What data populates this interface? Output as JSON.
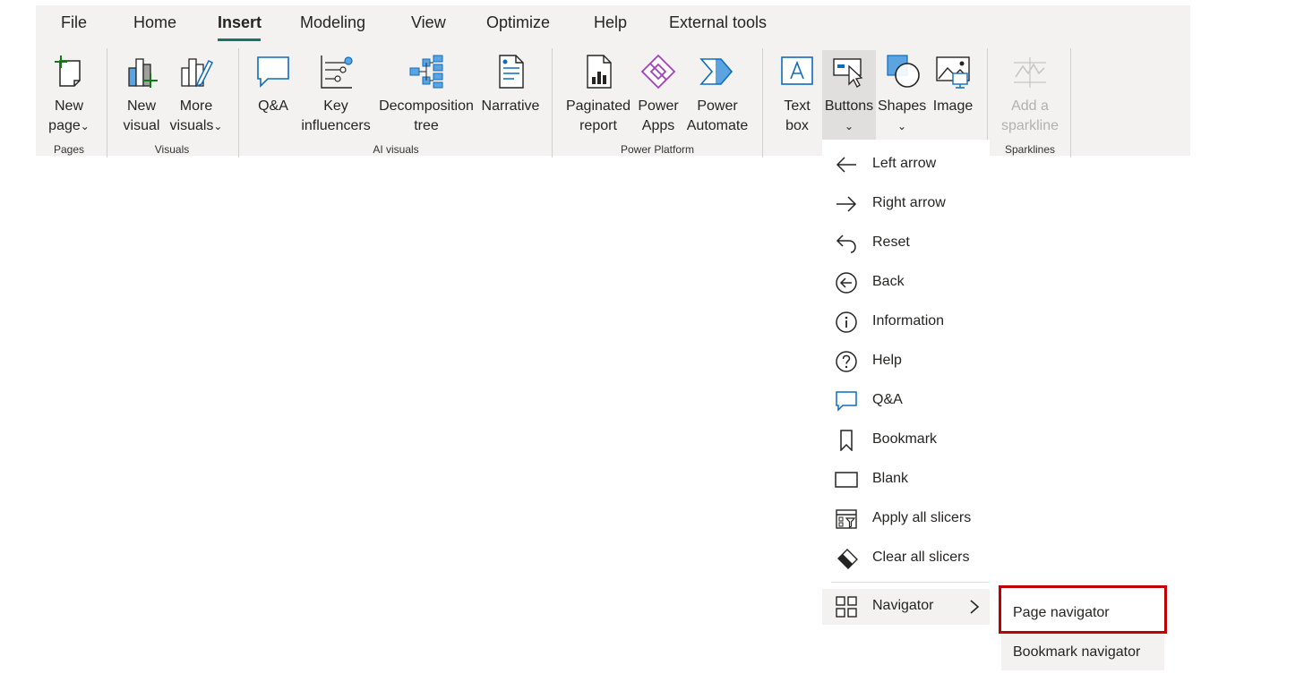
{
  "tabs": [
    "File",
    "Home",
    "Insert",
    "Modeling",
    "View",
    "Optimize",
    "Help",
    "External tools"
  ],
  "active_tab": "Insert",
  "ribbon": {
    "new_page": {
      "line1": "New",
      "line2": "page",
      "chevron": "⌄",
      "icon": "new-page-icon"
    },
    "new_visual": {
      "line1": "New",
      "line2": "visual",
      "icon": "new-visual-icon"
    },
    "more_visuals": {
      "line1": "More",
      "line2": "visuals",
      "chevron": "⌄",
      "icon": "more-visuals-icon"
    },
    "qa": {
      "line1": "Q&A",
      "icon": "qa-icon"
    },
    "key_influencers": {
      "line1": "Key",
      "line2": "influencers",
      "icon": "key-influencers-icon"
    },
    "decomposition_tree": {
      "line1": "Decomposition",
      "line2": "tree",
      "icon": "decomposition-tree-icon"
    },
    "narrative": {
      "line1": "Narrative",
      "icon": "narrative-icon"
    },
    "paginated_report": {
      "line1": "Paginated",
      "line2": "report",
      "icon": "paginated-report-icon"
    },
    "power_apps": {
      "line1": "Power",
      "line2": "Apps",
      "icon": "power-apps-icon"
    },
    "power_automate": {
      "line1": "Power",
      "line2": "Automate",
      "icon": "power-automate-icon"
    },
    "text_box": {
      "line1": "Text",
      "line2": "box",
      "icon": "text-box-icon"
    },
    "buttons": {
      "line1": "Buttons",
      "chevron": "⌄",
      "icon": "buttons-icon"
    },
    "shapes": {
      "line1": "Shapes",
      "chevron": "⌄",
      "icon": "shapes-icon"
    },
    "image": {
      "line1": "Image",
      "icon": "image-icon"
    },
    "sparkline": {
      "line1": "Add a",
      "line2": "sparkline",
      "icon": "sparkline-icon",
      "disabled": true
    }
  },
  "groups": {
    "pages": "Pages",
    "visuals": "Visuals",
    "ai_visuals": "AI visuals",
    "power_platform": "Power Platform",
    "sparklines": "Sparklines"
  },
  "buttons_menu": {
    "items": [
      {
        "label": "Left arrow",
        "icon": "left-arrow-icon"
      },
      {
        "label": "Right arrow",
        "icon": "right-arrow-icon"
      },
      {
        "label": "Reset",
        "icon": "reset-icon"
      },
      {
        "label": "Back",
        "icon": "back-icon"
      },
      {
        "label": "Information",
        "icon": "information-icon"
      },
      {
        "label": "Help",
        "icon": "help-icon"
      },
      {
        "label": "Q&A",
        "icon": "qa-icon"
      },
      {
        "label": "Bookmark",
        "icon": "bookmark-icon"
      },
      {
        "label": "Blank",
        "icon": "blank-icon"
      },
      {
        "label": "Apply all slicers",
        "icon": "apply-slicers-icon"
      },
      {
        "label": "Clear all slicers",
        "icon": "clear-slicers-icon"
      }
    ],
    "navigator": {
      "label": "Navigator",
      "icon": "navigator-icon"
    }
  },
  "navigator_submenu": {
    "items": [
      {
        "label": "Page navigator",
        "highlighted": true
      },
      {
        "label": "Bookmark navigator"
      }
    ]
  },
  "colors": {
    "accent": "#117865",
    "highlight_box": "#c00000",
    "icon_blue": "#0f6cbd",
    "power_apps_purple": "#a33fbf",
    "new_green": "#107c10"
  }
}
